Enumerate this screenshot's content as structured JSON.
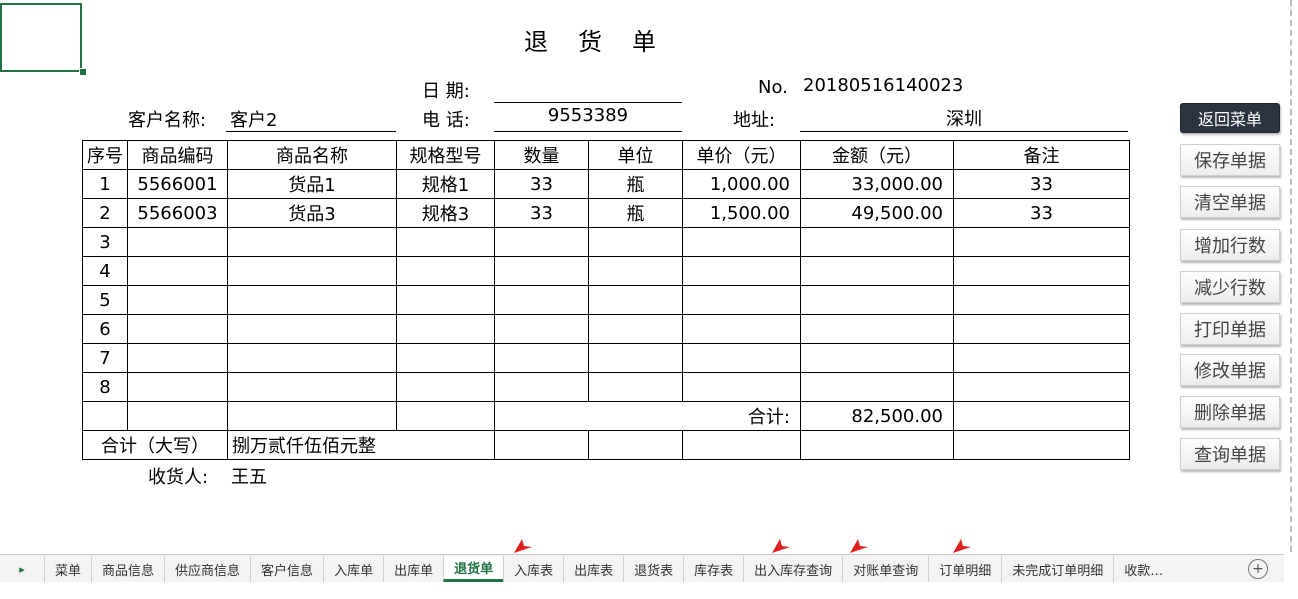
{
  "title": "退货单",
  "header": {
    "date_label": "日 期:",
    "date_value": "",
    "no_label": "No.",
    "no_value": "20180516140023",
    "customer_label": "客户名称:",
    "customer_value": "客户2",
    "phone_label": "电 话:",
    "phone_value": "9553389",
    "address_label": "地址:",
    "address_value": "深圳"
  },
  "table": {
    "columns": [
      "序号",
      "商品编码",
      "商品名称",
      "规格型号",
      "数量",
      "单位",
      "单价（元）",
      "金额（元）",
      "备注"
    ],
    "rows": [
      [
        "1",
        "5566001",
        "货品1",
        "规格1",
        "33",
        "瓶",
        "1,000.00",
        "33,000.00",
        "33"
      ],
      [
        "2",
        "5566003",
        "货品3",
        "规格3",
        "33",
        "瓶",
        "1,500.00",
        "49,500.00",
        "33"
      ],
      [
        "3",
        "",
        "",
        "",
        "",
        "",
        "",
        "",
        ""
      ],
      [
        "4",
        "",
        "",
        "",
        "",
        "",
        "",
        "",
        ""
      ],
      [
        "5",
        "",
        "",
        "",
        "",
        "",
        "",
        "",
        ""
      ],
      [
        "6",
        "",
        "",
        "",
        "",
        "",
        "",
        "",
        ""
      ],
      [
        "7",
        "",
        "",
        "",
        "",
        "",
        "",
        "",
        ""
      ],
      [
        "8",
        "",
        "",
        "",
        "",
        "",
        "",
        "",
        ""
      ]
    ],
    "total_label": "合计:",
    "total_value": "82,500.00",
    "total_caps_label": "合计（大写）",
    "total_caps_value": "捌万贰仟伍佰元整"
  },
  "receiver": {
    "label": "收货人:",
    "value": "王五"
  },
  "side_buttons": {
    "back": "返回菜单",
    "save": "保存单据",
    "clear": "清空单据",
    "add_row": "增加行数",
    "remove_row": "减少行数",
    "print": "打印单据",
    "edit": "修改单据",
    "delete": "删除单据",
    "query": "查询单据"
  },
  "tabs": [
    "菜单",
    "商品信息",
    "供应商信息",
    "客户信息",
    "入库单",
    "出库单",
    "退货单",
    "入库表",
    "出库表",
    "退货表",
    "库存表",
    "出入库存查询",
    "对账单查询",
    "订单明细",
    "未完成订单明细",
    "收款…"
  ],
  "active_tab": "退货单",
  "colors": {
    "accent": "#217346",
    "arrow": "#e02020"
  }
}
